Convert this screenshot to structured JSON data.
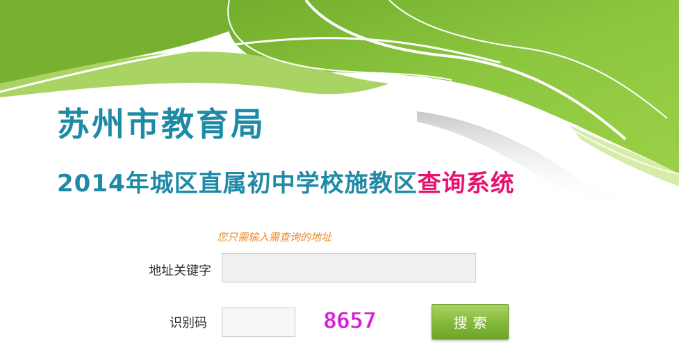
{
  "header": {
    "org_title": "苏州市教育局",
    "system_title_main": "2014年城区直属初中学校施教区",
    "system_title_accent": "查询系统"
  },
  "form": {
    "hint": "您只需输入需查询的地址",
    "address_label": "地址关键字",
    "address_value": "",
    "code_label": "识别码",
    "code_value": "",
    "captcha_text": "8657",
    "search_label": "搜索"
  },
  "colors": {
    "brand_green": "#8cc63f",
    "title_teal": "#1e8aa6",
    "accent_pink": "#e6136e",
    "hint_orange": "#e98a2e",
    "captcha_magenta": "#d21ad2"
  }
}
